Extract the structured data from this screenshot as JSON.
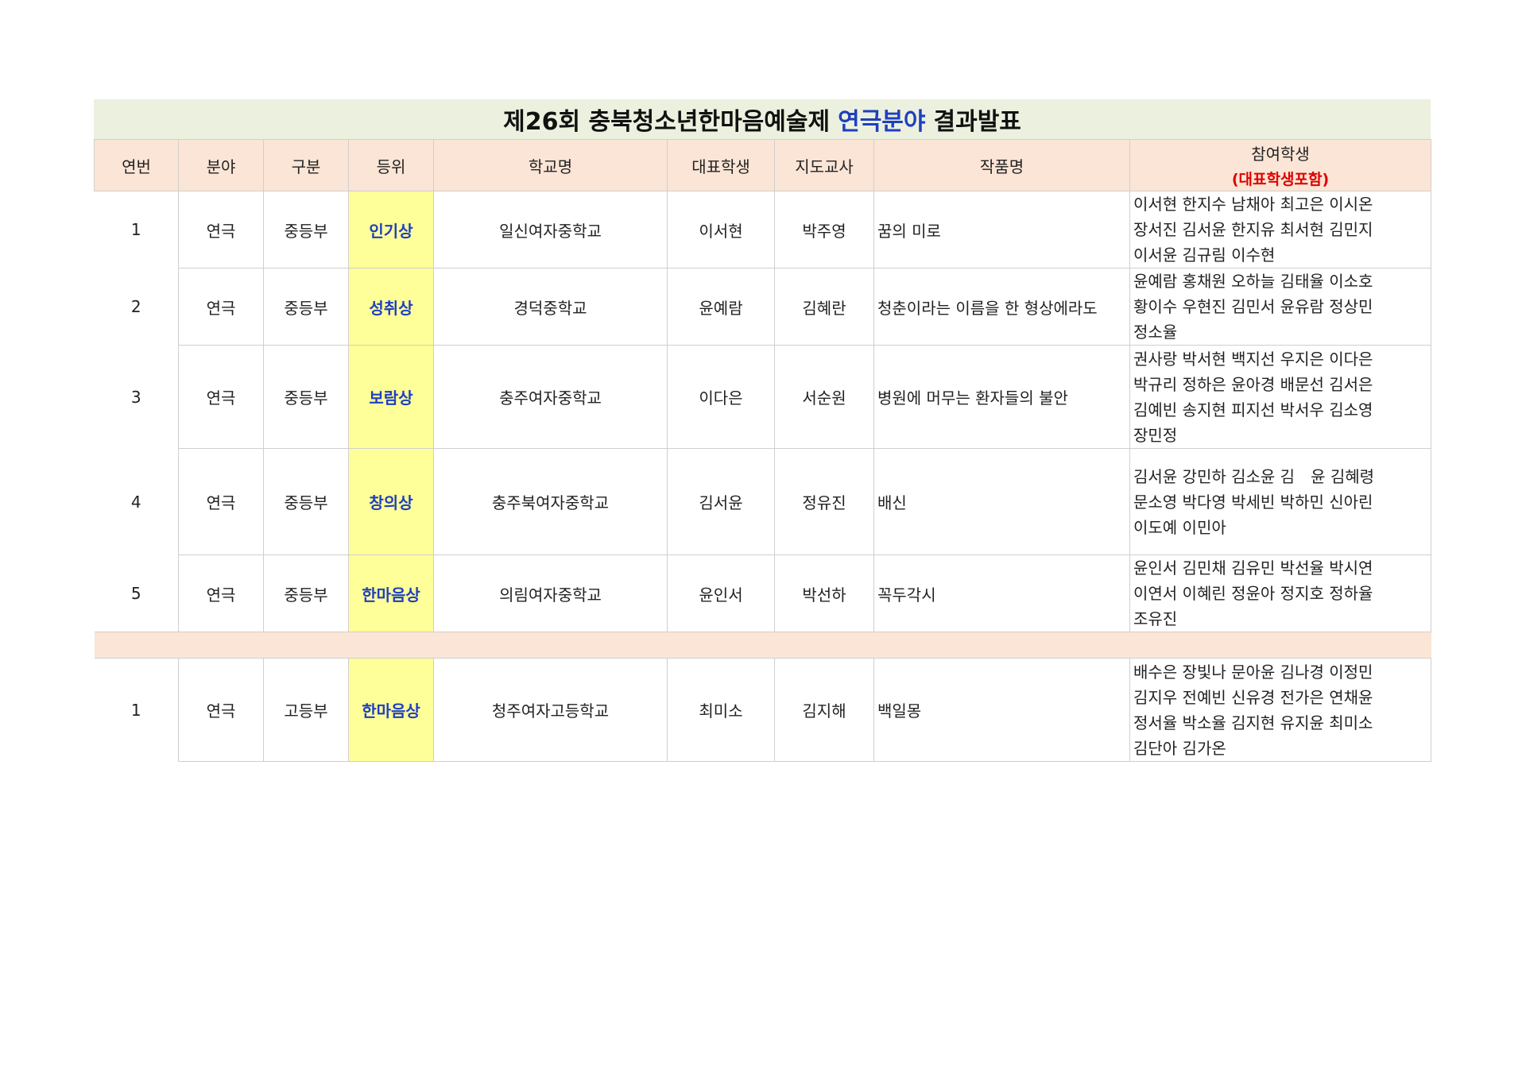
{
  "title": {
    "prefix": "제26회 충북청소년한마음예술제",
    "highlight": "연극분야",
    "suffix": "결과발표"
  },
  "headers": {
    "no": "연번",
    "field": "분야",
    "division": "구분",
    "rank": "등위",
    "school": "학교명",
    "rep": "대표학생",
    "teacher": "지도교사",
    "work": "작품명",
    "students": "참여학생",
    "students_note": "(대표학생포함)"
  },
  "rows": [
    {
      "no": "1",
      "field": "연극",
      "division": "중등부",
      "award": "인기상",
      "school": "일신여자중학교",
      "rep": "이서현",
      "teacher": "박주영",
      "work": "꿈의 미로",
      "students": [
        "이서현 한지수 남채아 최고은 이시온",
        "장서진 김서윤 한지유 최서현 김민지",
        "이서윤 김규림 이수현"
      ]
    },
    {
      "no": "2",
      "field": "연극",
      "division": "중등부",
      "award": "성취상",
      "school": "경덕중학교",
      "rep": "윤예람",
      "teacher": "김혜란",
      "work": "청춘이라는 이름을 한 형상에라도",
      "students": [
        "윤예람 홍채원 오하늘 김태율 이소호",
        "황이수 우현진 김민서 윤유람 정상민",
        "정소율"
      ]
    },
    {
      "no": "3",
      "field": "연극",
      "division": "중등부",
      "award": "보람상",
      "school": "충주여자중학교",
      "rep": "이다은",
      "teacher": "서순원",
      "work": "병원에 머무는 환자들의 불안",
      "students": [
        "권사랑 박서현 백지선 우지은 이다은",
        "박규리 정하은 윤아경 배문선 김서은",
        "김예빈 송지현 피지선 박서우 김소영",
        "장민정"
      ]
    },
    {
      "no": "4",
      "field": "연극",
      "division": "중등부",
      "award": "창의상",
      "school": "충주북여자중학교",
      "rep": "김서윤",
      "teacher": "정유진",
      "work": "배신",
      "students": [
        "김서윤 강민하 김소윤 김　윤 김혜령",
        "문소영 박다영 박세빈 박하민 신아린",
        "이도예 이민아"
      ]
    },
    {
      "no": "5",
      "field": "연극",
      "division": "중등부",
      "award": "한마음상",
      "school": "의림여자중학교",
      "rep": "윤인서",
      "teacher": "박선하",
      "work": "꼭두각시",
      "students": [
        "윤인서 김민채 김유민 박선율 박시연",
        "이연서 이혜린 정윤아 정지호 정하율",
        "조유진"
      ]
    }
  ],
  "rows_high": [
    {
      "no": "1",
      "field": "연극",
      "division": "고등부",
      "award": "한마음상",
      "school": "청주여자고등학교",
      "rep": "최미소",
      "teacher": "김지해",
      "work": "백일몽",
      "students": [
        "배수은 장빛나 문아윤 김나경 이정민",
        "김지우 전예빈 신유경 전가은 연채윤",
        "정서율 박소율 김지현 유지윤 최미소",
        "김단아 김가온"
      ]
    }
  ]
}
